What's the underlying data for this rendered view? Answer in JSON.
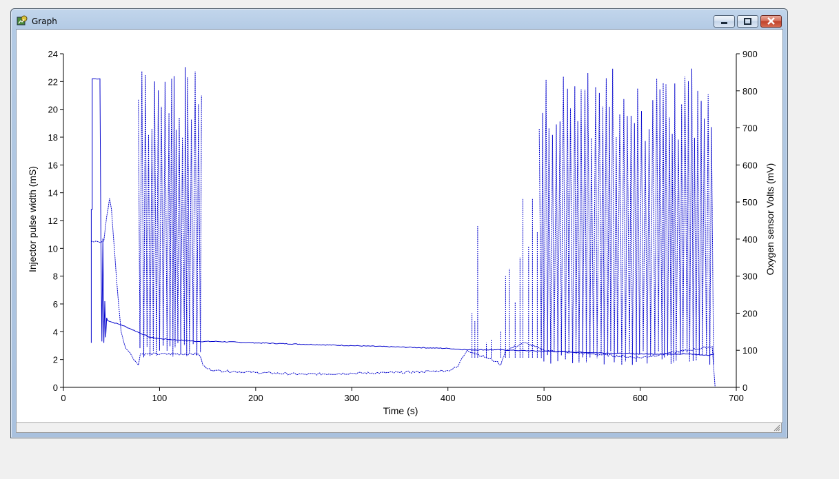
{
  "window": {
    "title": "Graph"
  },
  "chart_data": {
    "type": "line",
    "xlabel": "Time (s)",
    "ylabel_left": "Injector pulse width (mS)",
    "ylabel_right": "Oxygen sensor Volts (mV)",
    "xlim": [
      0,
      700
    ],
    "ylim_left": [
      0,
      24
    ],
    "ylim_right": [
      0,
      900
    ],
    "xticks": [
      0,
      100,
      200,
      300,
      400,
      500,
      600,
      700
    ],
    "yticks_left": [
      0,
      2,
      4,
      6,
      8,
      10,
      12,
      14,
      16,
      18,
      20,
      22,
      24
    ],
    "yticks_right": [
      0,
      100,
      200,
      300,
      400,
      500,
      600,
      700,
      800,
      900
    ],
    "grid": false,
    "color": "#0000cc",
    "series": [
      {
        "axis": "left",
        "style": "solid",
        "x": [
          29,
          29,
          30,
          30,
          38,
          38,
          39,
          40,
          41,
          42,
          43,
          44,
          45,
          46,
          50,
          60,
          70,
          80,
          90,
          100,
          120,
          140,
          160,
          200,
          300,
          400,
          420,
          450,
          500,
          550,
          600,
          650,
          670,
          677
        ],
        "y": [
          3.2,
          12.8,
          12.8,
          22.2,
          22.2,
          21.8,
          10.5,
          3.3,
          10.7,
          3.2,
          6.2,
          3.6,
          5.0,
          4.8,
          4.7,
          4.5,
          4.2,
          3.9,
          3.6,
          3.5,
          3.4,
          3.3,
          3.3,
          3.2,
          3.0,
          2.8,
          2.7,
          2.7,
          2.6,
          2.5,
          2.4,
          2.4,
          2.3,
          2.4
        ]
      },
      {
        "axis": "right",
        "style": "dashed",
        "x": [
          29,
          32,
          37,
          40,
          42,
          45,
          48,
          50,
          55,
          60,
          65,
          70,
          75,
          78,
          80,
          140,
          143,
          145,
          150,
          160,
          200,
          250,
          300,
          350,
          400,
          410,
          415,
          420,
          430,
          440,
          450,
          455,
          460,
          480,
          500,
          550,
          600,
          650,
          675,
          678
        ],
        "y": [
          395,
          393,
          392,
          393,
          395,
          460,
          510,
          480,
          300,
          150,
          105,
          90,
          70,
          60,
          90,
          90,
          80,
          60,
          50,
          45,
          40,
          35,
          38,
          40,
          45,
          55,
          80,
          100,
          90,
          80,
          70,
          60,
          100,
          120,
          100,
          90,
          80,
          100,
          110,
          0
        ]
      }
    ],
    "bursts": [
      {
        "from": 78,
        "to": 144,
        "low": 80,
        "high": 870,
        "period": 2.1
      },
      {
        "from": 495,
        "to": 677,
        "low": 60,
        "high": 860,
        "period": 2.4
      }
    ]
  }
}
